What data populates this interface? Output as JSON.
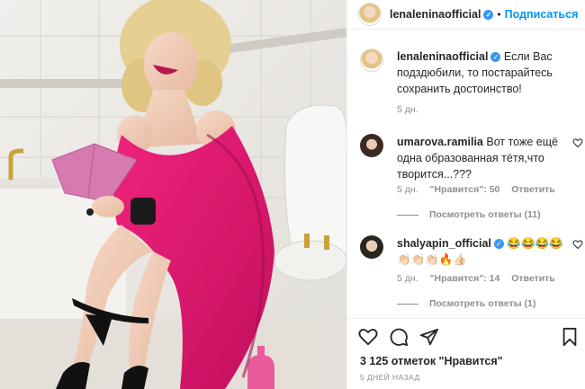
{
  "post": {
    "author": "lenaleninaofficial",
    "follow_label": "Подписаться",
    "dot": "•"
  },
  "comments": [
    {
      "username": "lenaleninaofficial",
      "text": "Если Вас подздюбили, то постарайтесь сохранить достоинство!",
      "time": "5 дн."
    },
    {
      "username": "umarova.ramilia",
      "text": "Вот тоже ещё одна образованная тётя,что творится...???",
      "time": "5 дн.",
      "likes": "\"Нравится\": 50",
      "reply": "Ответить",
      "view_replies": "Посмотреть ответы (11)"
    },
    {
      "username": "shalyapin_official",
      "text": "😂😂😂😂👏🏻👏🏻👏🏻🔥👍🏻",
      "time": "5 дн.",
      "likes": "\"Нравится\": 14",
      "reply": "Ответить",
      "view_replies": "Посмотреть ответы (1)"
    }
  ],
  "footer": {
    "likes_count": "3 125 отметок \"Нравится\"",
    "date": "5 ДНЕЙ НАЗАД"
  },
  "icons": [
    "verified-icon",
    "heart-icon",
    "comment-icon",
    "share-icon",
    "bookmark-icon"
  ],
  "colors": {
    "accent": "#0095f6",
    "verified": "#3897f0",
    "dress": "#e0146e",
    "muted": "#8e8e8e"
  }
}
